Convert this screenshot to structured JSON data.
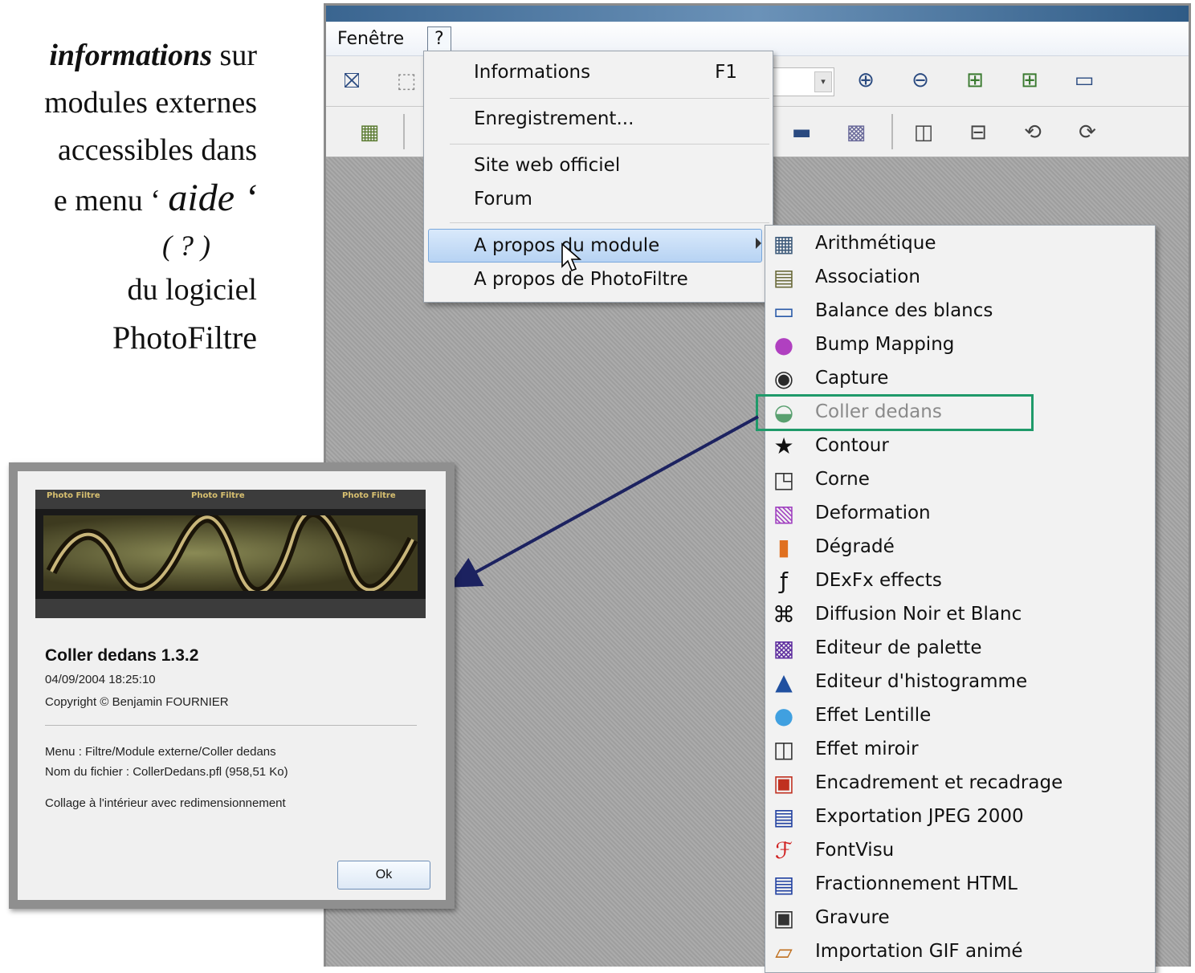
{
  "caption": {
    "line1_em": "informations",
    "line1_rest": " sur",
    "line2": "modules externes",
    "line3": "accessibles dans",
    "line4_pre": "e menu ‘ ",
    "line4_em": "aide ‘",
    "line5": "( ? )",
    "line6": "du logiciel",
    "line7": "PhotoFiltre"
  },
  "menubar": {
    "fenetre": "Fenêtre",
    "help": "?"
  },
  "help_menu": {
    "informations": "Informations",
    "informations_shortcut": "F1",
    "enregistrement": "Enregistrement...",
    "site_web": "Site web officiel",
    "forum": "Forum",
    "a_propos_module": "A propos du module",
    "a_propos_photofiltre": "A propos de PhotoFiltre"
  },
  "submenu": {
    "items": [
      {
        "label": "Arithmétique",
        "icon": "calculator-icon"
      },
      {
        "label": "Association",
        "icon": "association-icon"
      },
      {
        "label": "Balance des blancs",
        "icon": "monitor-icon"
      },
      {
        "label": "Bump Mapping",
        "icon": "bump-mapping-icon"
      },
      {
        "label": "Capture",
        "icon": "camera-icon"
      },
      {
        "label": "Coller dedans",
        "icon": "paste-inside-icon"
      },
      {
        "label": "Contour",
        "icon": "star-icon"
      },
      {
        "label": "Corne",
        "icon": "page-corner-icon"
      },
      {
        "label": "Deformation",
        "icon": "deformation-icon"
      },
      {
        "label": "Dégradé",
        "icon": "gradient-icon"
      },
      {
        "label": "DExFx effects",
        "icon": "fx-icon"
      },
      {
        "label": "Diffusion Noir et Blanc",
        "icon": "diffusion-icon"
      },
      {
        "label": "Editeur de palette",
        "icon": "palette-icon"
      },
      {
        "label": "Editeur d'histogramme",
        "icon": "histogram-icon"
      },
      {
        "label": "Effet Lentille",
        "icon": "lens-icon"
      },
      {
        "label": "Effet miroir",
        "icon": "mirror-icon"
      },
      {
        "label": "Encadrement et recadrage",
        "icon": "frame-icon"
      },
      {
        "label": "Exportation JPEG 2000",
        "icon": "jpeg2000-icon"
      },
      {
        "label": "FontVisu",
        "icon": "font-icon"
      },
      {
        "label": "Fractionnement HTML",
        "icon": "html-icon"
      },
      {
        "label": "Gravure",
        "icon": "engraving-icon"
      },
      {
        "label": "Importation GIF animé",
        "icon": "gif-icon"
      }
    ]
  },
  "dialog": {
    "film_label": "Photo Filtre",
    "title": "Coller dedans 1.3.2",
    "date": "04/09/2004 18:25:10",
    "copyright": "Copyright © Benjamin FOURNIER",
    "menu_path": "Menu : Filtre/Module externe/Coller dedans",
    "file_name": "Nom du fichier : CollerDedans.pfl (958,51 Ko)",
    "description": "Collage à l'intérieur avec redimensionnement",
    "ok": "Ok"
  },
  "colors": {
    "highlight_box": "#1f9a6a",
    "arrow": "#1c2260",
    "menu_highlight": "#c8dff7"
  }
}
